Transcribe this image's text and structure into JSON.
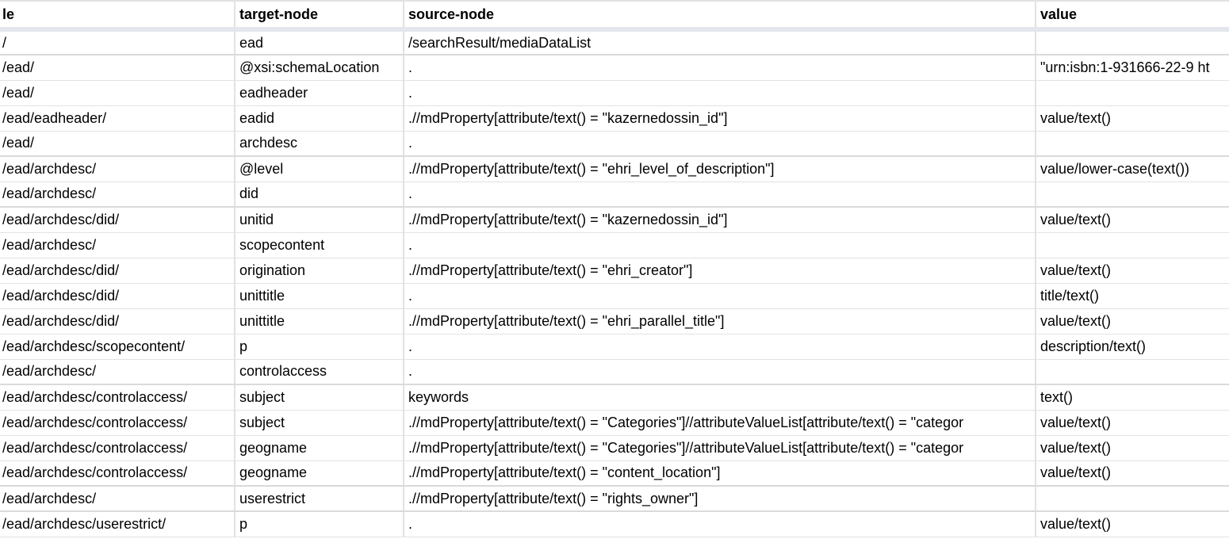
{
  "columns": [
    "le",
    "target-node",
    "source-node",
    "value"
  ],
  "rows": [
    [
      "/",
      "ead",
      "/searchResult/mediaDataList",
      ""
    ],
    [
      "/ead/",
      "@xsi:schemaLocation",
      ".",
      "\"urn:isbn:1-931666-22-9 ht"
    ],
    [
      "/ead/",
      "eadheader",
      ".",
      ""
    ],
    [
      "/ead/eadheader/",
      "eadid",
      ".//mdProperty[attribute/text() = \"kazernedossin_id\"]",
      "value/text()"
    ],
    [
      "/ead/",
      "archdesc",
      ".",
      ""
    ],
    [
      "/ead/archdesc/",
      "@level",
      ".//mdProperty[attribute/text() = \"ehri_level_of_description\"]",
      "value/lower-case(text())"
    ],
    [
      "/ead/archdesc/",
      "did",
      ".",
      ""
    ],
    [
      "/ead/archdesc/did/",
      "unitid",
      ".//mdProperty[attribute/text() = \"kazernedossin_id\"]",
      "value/text()"
    ],
    [
      "/ead/archdesc/",
      "scopecontent",
      ".",
      ""
    ],
    [
      "/ead/archdesc/did/",
      "origination",
      ".//mdProperty[attribute/text() = \"ehri_creator\"]",
      "value/text()"
    ],
    [
      "/ead/archdesc/did/",
      "unittitle",
      ".",
      "title/text()"
    ],
    [
      "/ead/archdesc/did/",
      "unittitle",
      ".//mdProperty[attribute/text() = \"ehri_parallel_title\"]",
      "value/text()"
    ],
    [
      "/ead/archdesc/scopecontent/",
      "p",
      ".",
      "description/text()"
    ],
    [
      "/ead/archdesc/",
      "controlaccess",
      ".",
      ""
    ],
    [
      "/ead/archdesc/controlaccess/",
      "subject",
      "keywords",
      "text()"
    ],
    [
      "/ead/archdesc/controlaccess/",
      "subject",
      ".//mdProperty[attribute/text() = \"Categories\"]//attributeValueList[attribute/text() = \"categor",
      "value/text()"
    ],
    [
      "/ead/archdesc/controlaccess/",
      "geogname",
      ".//mdProperty[attribute/text() = \"Categories\"]//attributeValueList[attribute/text() = \"categor",
      "value/text()"
    ],
    [
      "/ead/archdesc/controlaccess/",
      "geogname",
      ".//mdProperty[attribute/text() = \"content_location\"]",
      "value/text()"
    ],
    [
      "/ead/archdesc/",
      "userestrict",
      ".//mdProperty[attribute/text() = \"rights_owner\"]",
      ""
    ],
    [
      "/ead/archdesc/userestrict/",
      "p",
      ".",
      "value/text()"
    ]
  ]
}
